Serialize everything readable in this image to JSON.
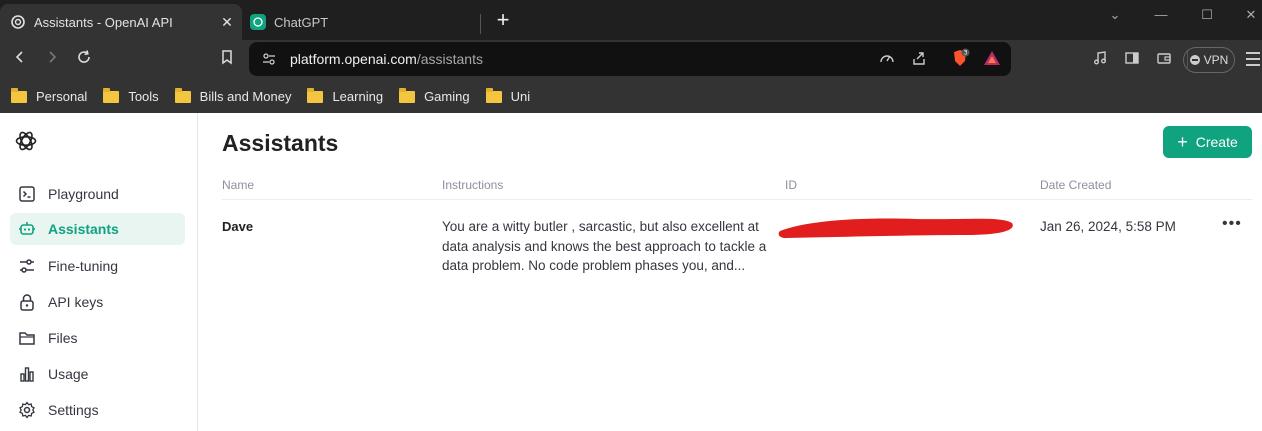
{
  "browser": {
    "tabs": [
      {
        "title": "Assistants - OpenAI API",
        "active": true
      },
      {
        "title": "ChatGPT",
        "active": false
      }
    ],
    "url_host": "platform.openai.com",
    "url_path": "/assistants",
    "brave_badge_count": "3",
    "vpn_label": "VPN",
    "bookmarks": [
      "Personal",
      "Tools",
      "Bills and Money",
      "Learning",
      "Gaming",
      "Uni"
    ]
  },
  "sidebar": {
    "items": [
      {
        "label": "Playground",
        "icon": "terminal-icon",
        "active": false
      },
      {
        "label": "Assistants",
        "icon": "robot-icon",
        "active": true
      },
      {
        "label": "Fine-tuning",
        "icon": "sliders-icon",
        "active": false
      },
      {
        "label": "API keys",
        "icon": "lock-icon",
        "active": false
      },
      {
        "label": "Files",
        "icon": "folder-icon",
        "active": false
      },
      {
        "label": "Usage",
        "icon": "bar-chart-icon",
        "active": false
      },
      {
        "label": "Settings",
        "icon": "gear-icon",
        "active": false
      }
    ]
  },
  "main": {
    "title": "Assistants",
    "create_label": "Create",
    "columns": {
      "name": "Name",
      "instructions": "Instructions",
      "id": "ID",
      "date": "Date Created"
    },
    "rows": [
      {
        "name": "Dave",
        "instructions": "You are a witty butler , sarcastic, but also excellent at data analysis and knows the best approach to tackle a data problem. No code problem phases you, and...",
        "id": "",
        "date_created": "Jan 26, 2024, 5:58 PM"
      }
    ]
  },
  "colors": {
    "accent": "#10a37f",
    "redaction": "#e11d1d"
  }
}
